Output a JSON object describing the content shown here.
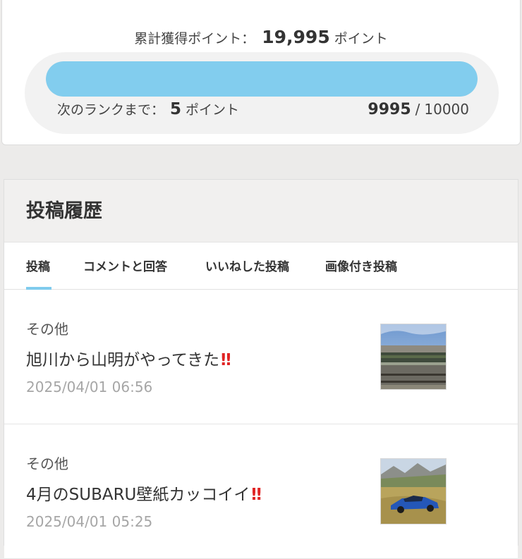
{
  "points": {
    "total_label": "累計獲得ポイント：",
    "total_value": "19,995",
    "total_unit": "ポイント",
    "next_rank_label": "次のランクまで：",
    "next_rank_value": "5",
    "next_rank_unit": "ポイント",
    "progress_current": "9995",
    "progress_separator": "/",
    "progress_max": "10000",
    "progress_fraction": 0.9995,
    "progress_color": "#82cdee"
  },
  "history": {
    "title": "投稿履歴",
    "tabs": [
      {
        "label": "投稿",
        "active": true
      },
      {
        "label": "コメントと回答",
        "active": false
      },
      {
        "label": "いいねした投稿",
        "active": false
      },
      {
        "label": "画像付き投稿",
        "active": false
      }
    ],
    "posts": [
      {
        "category": "その他",
        "title": "旭川から山明がやってきた",
        "emoji": "‼",
        "date": "2025/04/01 06:56",
        "thumbnail": "train-photo"
      },
      {
        "category": "その他",
        "title": "4月のSUBARU壁紙カッコイイ",
        "emoji": "‼",
        "date": "2025/04/01 05:25",
        "thumbnail": "car-photo"
      }
    ]
  },
  "accent_color": "#7fcbed",
  "alert_color": "#e02424"
}
